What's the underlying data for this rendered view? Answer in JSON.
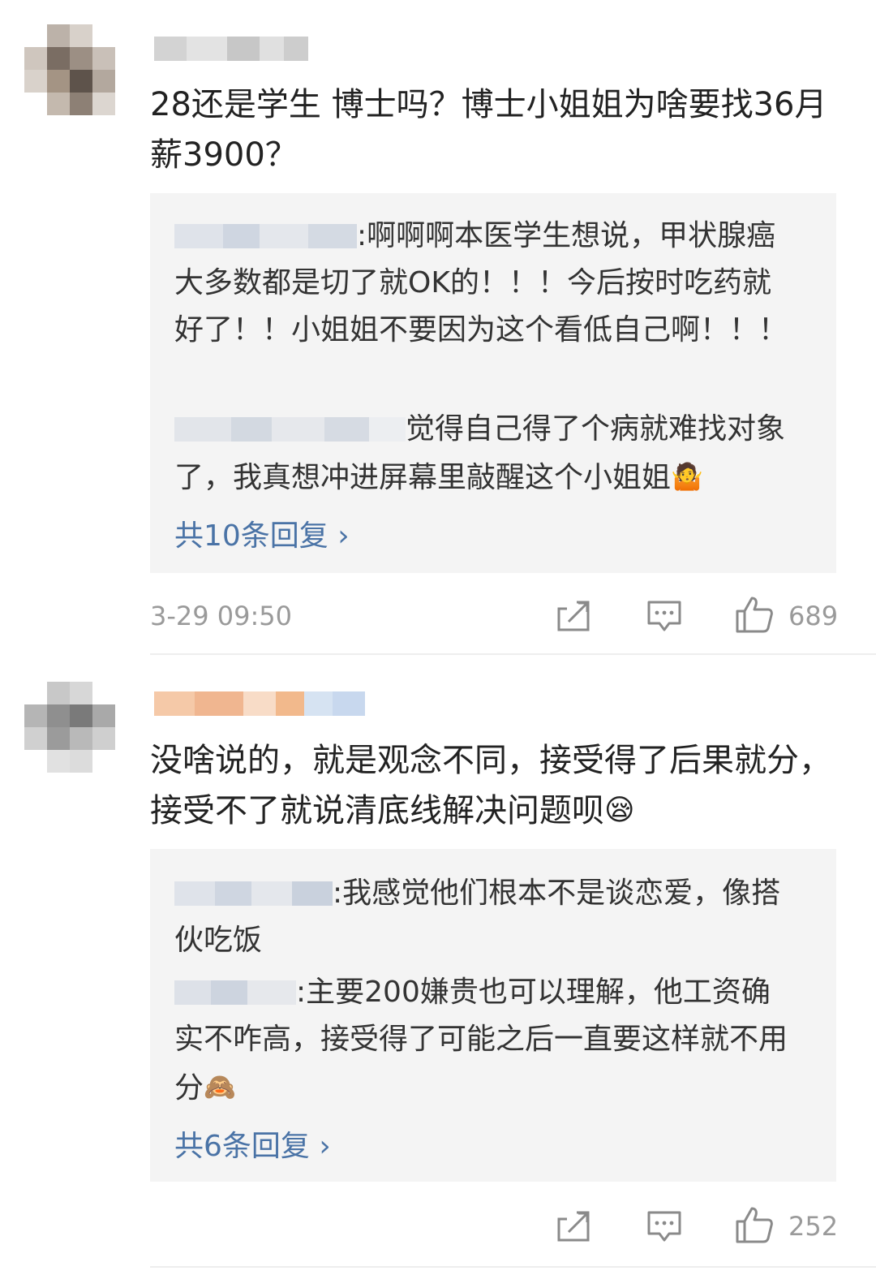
{
  "comments": [
    {
      "text": "28还是学生 博士吗？博士小姐姐为啥要找36月薪3900？",
      "replies": [
        {
          "sep": ":",
          "text": "啊啊啊本医学生想说，甲状腺癌大多数都是切了就OK的！！！今后按时吃药就好了！！小姐姐不要因为这个看低自己啊！！！"
        },
        {
          "sep": "",
          "text": "觉得自己得了个病就难找对象了，我真想冲进屏幕里敲醒这个小姐姐",
          "emoji": "🤷"
        }
      ],
      "more_replies": "共10条回复 ›",
      "time": "3-29 09:50",
      "likes": "689"
    },
    {
      "text": "没啥说的，就是观念不同，接受得了后果就分，接受不了就说清底线解决问题呗",
      "emoji": "😪",
      "replies": [
        {
          "sep": ":",
          "text": "我感觉他们根本不是谈恋爱，像搭伙吃饭"
        },
        {
          "sep": ":",
          "text": "主要200嫌贵也可以理解，他工资确实不咋高，接受得了可能之后一直要这样就不用分",
          "emoji": "🙈"
        }
      ],
      "more_replies": "共6条回复 ›",
      "likes": "252"
    }
  ],
  "icons": {
    "share": "share-icon",
    "comment": "comment-icon",
    "like": "thumbs-up-icon"
  },
  "colors": {
    "link": "#4a73a6",
    "meta": "#9a9a9a",
    "reply_bg": "#f4f4f4"
  }
}
